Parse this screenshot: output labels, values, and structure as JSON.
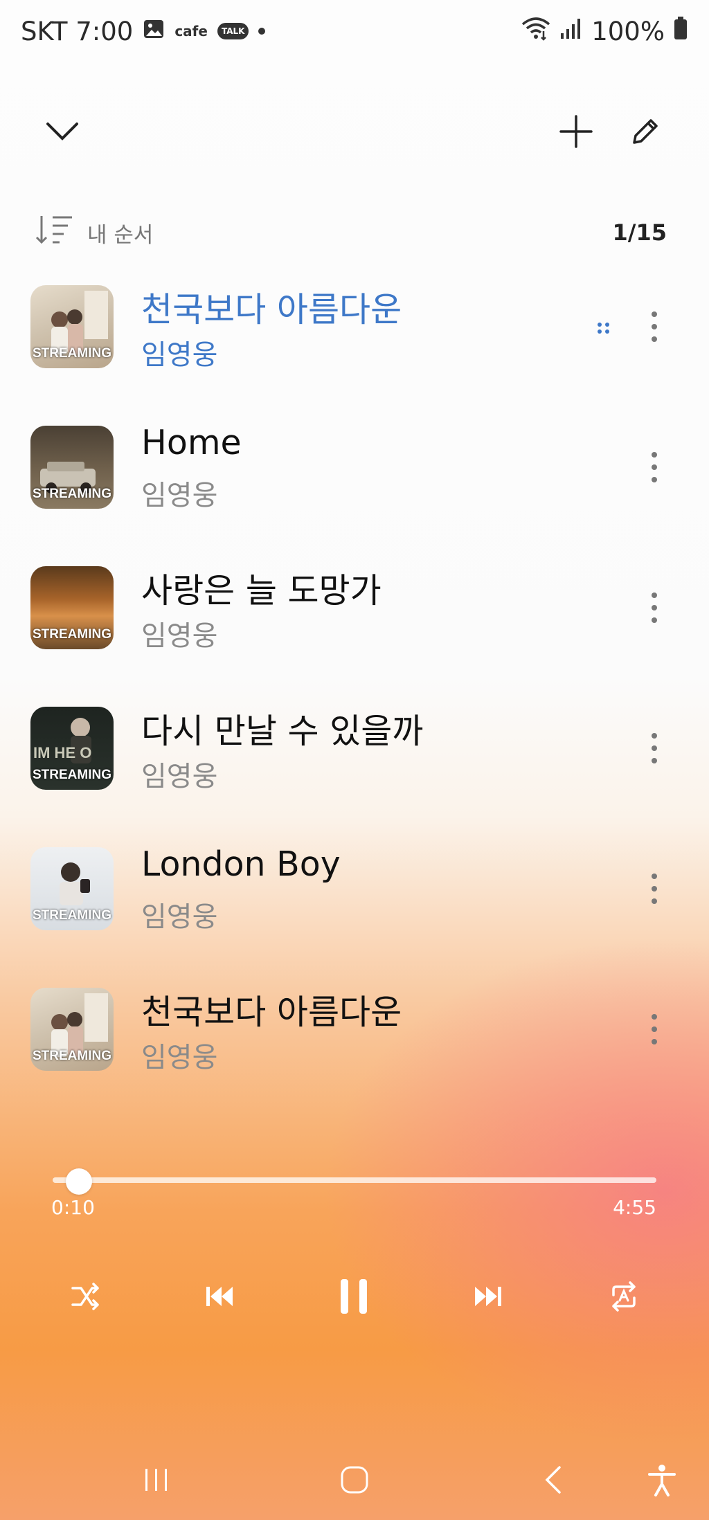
{
  "status_bar": {
    "carrier_time": "SKT 7:00",
    "cafe": "cafe",
    "talk": "TALK",
    "battery": "100%"
  },
  "header": {
    "sort_label": "내 순서",
    "count": "1/15"
  },
  "playlist": [
    {
      "title": "천국보다 아름다운",
      "artist": "임영웅",
      "badge": "STREAMING",
      "active": true
    },
    {
      "title": "Home",
      "artist": "임영웅",
      "badge": "STREAMING",
      "active": false
    },
    {
      "title": "사랑은 늘 도망가",
      "artist": "임영웅",
      "badge": "STREAMING",
      "active": false
    },
    {
      "title": "다시 만날 수 있을까",
      "artist": "임영웅",
      "badge": "STREAMING",
      "active": false
    },
    {
      "title": "London Boy",
      "artist": "임영웅",
      "badge": "STREAMING",
      "active": false
    },
    {
      "title": "천국보다 아름다운",
      "artist": "임영웅",
      "badge": "STREAMING",
      "active": false
    }
  ],
  "album_text": {
    "im_hero": "IM HE O"
  },
  "player": {
    "elapsed": "0:10",
    "duration": "4:55",
    "progress_fraction": 0.034
  },
  "colors": {
    "accent": "#3e78c8"
  },
  "icons": [
    "chevron-down-icon",
    "plus-icon",
    "pencil-icon",
    "sort-icon",
    "more-vert-icon",
    "drag-handle-icon",
    "shuffle-icon",
    "previous-icon",
    "pause-icon",
    "next-icon",
    "repeat-one-icon",
    "recents-icon",
    "home-icon",
    "back-icon",
    "accessibility-icon"
  ]
}
